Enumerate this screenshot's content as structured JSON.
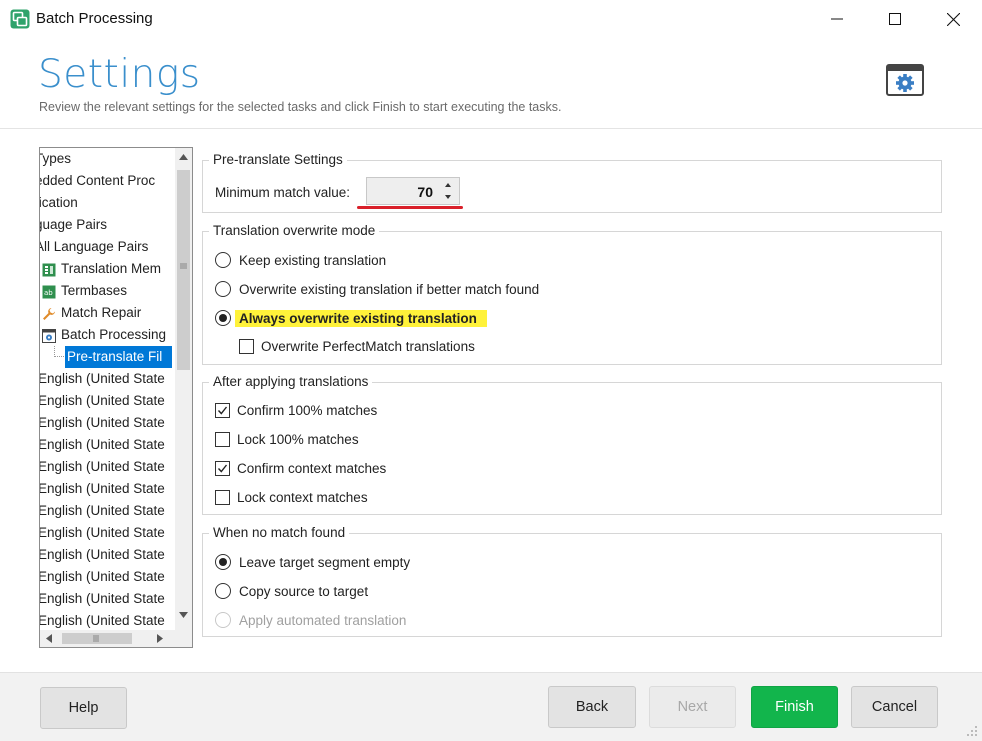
{
  "window": {
    "title": "Batch Processing"
  },
  "header": {
    "title": "Settings",
    "subtitle": "Review the relevant settings for the selected tasks and click Finish to start executing the tasks."
  },
  "tree": {
    "items": [
      {
        "label": "Types",
        "icon": ""
      },
      {
        "label": "edded Content Proc",
        "icon": ""
      },
      {
        "label": "fication",
        "icon": ""
      },
      {
        "label": "guage Pairs",
        "icon": ""
      },
      {
        "label": "All Language Pairs",
        "icon": ""
      },
      {
        "label": "Translation Mem",
        "icon": "translation-memory-icon"
      },
      {
        "label": "Termbases",
        "icon": "termbase-icon"
      },
      {
        "label": "Match Repair",
        "icon": "wrench-icon"
      },
      {
        "label": "Batch Processing",
        "icon": "batch-processing-icon"
      },
      {
        "label": "Pre-translate Fil",
        "icon": "",
        "selected": true
      },
      {
        "label": "English (United State"
      },
      {
        "label": "English (United State"
      },
      {
        "label": "English (United State"
      },
      {
        "label": "English (United State"
      },
      {
        "label": "English (United State"
      },
      {
        "label": "English (United State"
      },
      {
        "label": "English (United State"
      },
      {
        "label": "English (United State"
      },
      {
        "label": "English (United State"
      },
      {
        "label": "English (United State"
      },
      {
        "label": "English (United State"
      },
      {
        "label": "English (United State"
      }
    ]
  },
  "pretranslate": {
    "group_title": "Pre-translate Settings",
    "min_match_label": "Minimum match value:",
    "min_match_value": "70"
  },
  "overwrite": {
    "group_title": "Translation overwrite mode",
    "options": [
      {
        "label": "Keep existing translation",
        "selected": false
      },
      {
        "label": "Overwrite existing translation if better match found",
        "selected": false
      },
      {
        "label": "Always overwrite existing translation",
        "selected": true
      }
    ],
    "perfectmatch_label": "Overwrite PerfectMatch translations",
    "perfectmatch_checked": false
  },
  "after": {
    "group_title": "After applying translations",
    "options": [
      {
        "label": "Confirm 100% matches",
        "checked": true
      },
      {
        "label": "Lock 100% matches",
        "checked": false
      },
      {
        "label": "Confirm context matches",
        "checked": true
      },
      {
        "label": "Lock context matches",
        "checked": false
      }
    ]
  },
  "nomatch": {
    "group_title": "When no match found",
    "options": [
      {
        "label": "Leave target segment empty",
        "selected": true
      },
      {
        "label": "Copy source to target",
        "selected": false
      },
      {
        "label": "Apply automated translation",
        "selected": false,
        "disabled": true
      }
    ]
  },
  "footer": {
    "help": "Help",
    "back": "Back",
    "next": "Next",
    "finish": "Finish",
    "cancel": "Cancel"
  },
  "colors": {
    "accent": "#3a8fcc",
    "finish": "#12b54c",
    "selection": "#0078d7",
    "highlight": "#fff23a",
    "underline": "#d9202a"
  }
}
